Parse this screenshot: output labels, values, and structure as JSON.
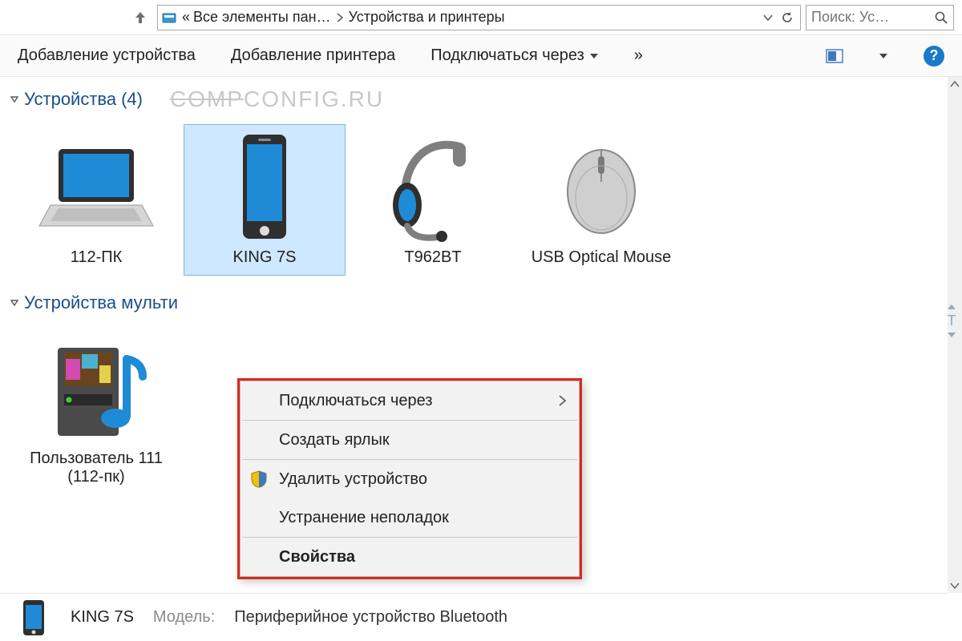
{
  "address": {
    "up_tooltip": "Вверх",
    "prefix": "«",
    "segment1": "Все элементы пан…",
    "segment2": "Устройства и принтеры"
  },
  "search": {
    "placeholder": "Поиск: Ус…"
  },
  "toolbar": {
    "add_device": "Добавление устройства",
    "add_printer": "Добавление принтера",
    "connect_via": "Подключаться через",
    "more": "»"
  },
  "groups": {
    "devices": {
      "title": "Устройства",
      "count": "(4)",
      "watermark": "COMPCONFIG.RU"
    },
    "multimedia": {
      "title": "Устройства мульти"
    }
  },
  "devices": [
    {
      "label": "112-ПК"
    },
    {
      "label": "KING 7S"
    },
    {
      "label": "T962BT"
    },
    {
      "label": "USB Optical Mouse"
    }
  ],
  "multimedia_devices": [
    {
      "label": "Пользователь 111 (112-пк)"
    }
  ],
  "context_menu": {
    "connect_via": "Подключаться через",
    "create_shortcut": "Создать ярлык",
    "remove_device": "Удалить устройство",
    "troubleshoot": "Устранение неполадок",
    "properties": "Свойства"
  },
  "details": {
    "name": "KING 7S",
    "model_key": "Модель:",
    "model_val": "Периферийное устройство Bluetooth"
  }
}
